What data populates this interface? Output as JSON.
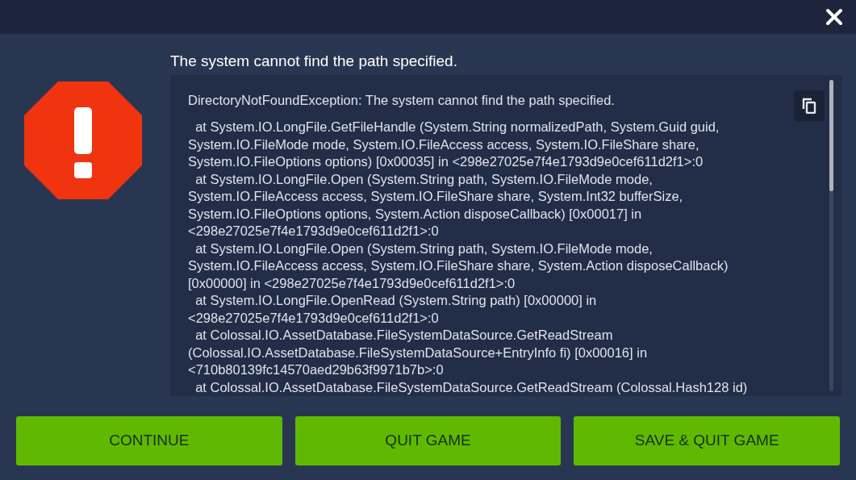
{
  "title": "The system cannot find the path specified.",
  "log": {
    "message": "DirectoryNotFoundException: The system cannot find the path specified.",
    "trace_lines": [
      "  at System.IO.LongFile.GetFileHandle (System.String normalizedPath, System.Guid guid,",
      "System.IO.FileMode mode, System.IO.FileAccess access, System.IO.FileShare share,",
      "System.IO.FileOptions options) [0x00035] in <298e27025e7f4e1793d9e0cef611d2f1>:0",
      "  at System.IO.LongFile.Open (System.String path, System.IO.FileMode mode,",
      "System.IO.FileAccess access, System.IO.FileShare share, System.Int32 bufferSize,",
      "System.IO.FileOptions options, System.Action disposeCallback) [0x00017] in",
      "<298e27025e7f4e1793d9e0cef611d2f1>:0",
      "  at System.IO.LongFile.Open (System.String path, System.IO.FileMode mode,",
      "System.IO.FileAccess access, System.IO.FileShare share, System.Action disposeCallback)",
      "[0x00000] in <298e27025e7f4e1793d9e0cef611d2f1>:0",
      "  at System.IO.LongFile.OpenRead (System.String path) [0x00000] in",
      "<298e27025e7f4e1793d9e0cef611d2f1>:0",
      "  at Colossal.IO.AssetDatabase.FileSystemDataSource.GetReadStream",
      "(Colossal.IO.AssetDatabase.FileSystemDataSource+EntryInfo fi) [0x00016] in",
      "<710b80139fc14570aed29b63f9971b7b>:0",
      "  at Colossal.IO.AssetDatabase.FileSystemDataSource.GetReadStream (Colossal.Hash128 id)"
    ]
  },
  "buttons": [
    "CONTINUE",
    "QUIT GAME",
    "SAVE & QUIT GAME"
  ]
}
